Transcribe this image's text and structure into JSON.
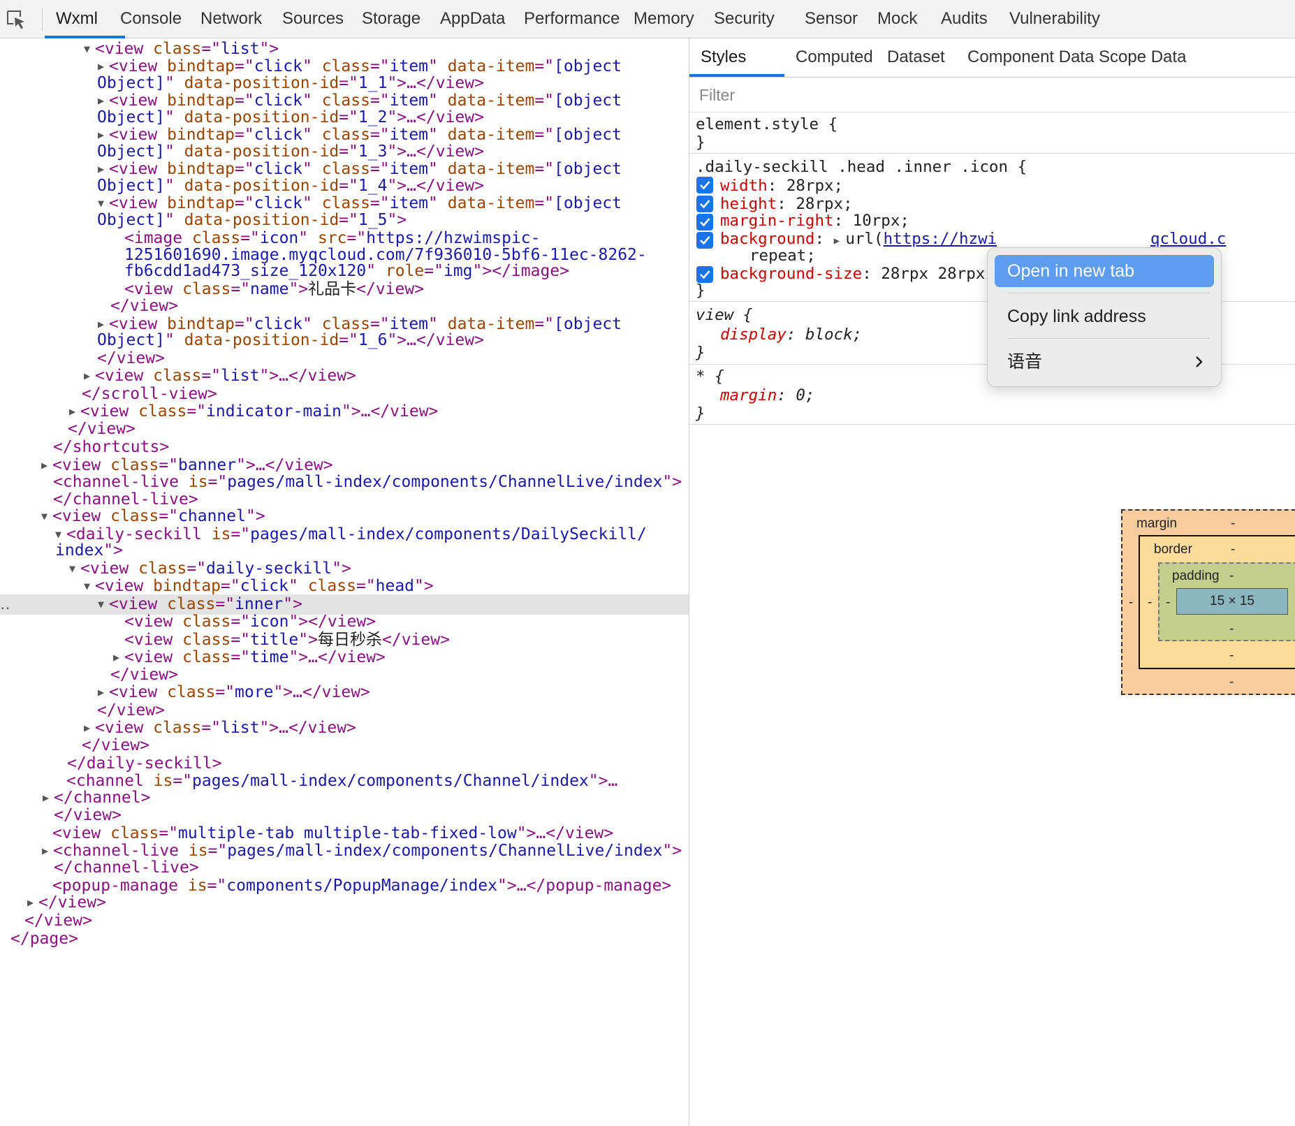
{
  "toolbar": {
    "tabs": [
      "Wxml",
      "Console",
      "Network",
      "Sources",
      "Storage",
      "AppData",
      "Performance",
      "Memory",
      "Security",
      "Sensor",
      "Mock",
      "Audits",
      "Vulnerability"
    ],
    "active_tab": "Wxml"
  },
  "tree": {
    "lines": [
      [
        [
          "t",
          "<view "
        ],
        [
          "a",
          "class"
        ],
        [
          "t",
          "=\""
        ],
        [
          "v",
          "list"
        ],
        [
          "t",
          "\">"
        ]
      ],
      [
        [
          "t",
          "<view "
        ],
        [
          "a",
          "bindtap"
        ],
        [
          "t",
          "=\""
        ],
        [
          "v",
          "click"
        ],
        [
          "t",
          "\" "
        ],
        [
          "a",
          "class"
        ],
        [
          "t",
          "=\""
        ],
        [
          "v",
          "item"
        ],
        [
          "t",
          "\" "
        ],
        [
          "a",
          "data-item"
        ],
        [
          "t",
          "=\""
        ],
        [
          "v",
          "[object"
        ]
      ],
      [
        [
          "v",
          "Object]"
        ],
        [
          "t",
          "\" "
        ],
        [
          "a",
          "data-position-id"
        ],
        [
          "t",
          "=\""
        ],
        [
          "v",
          "1_1"
        ],
        [
          "t",
          "\">…</view>"
        ]
      ],
      [
        [
          "t",
          "<view "
        ],
        [
          "a",
          "bindtap"
        ],
        [
          "t",
          "=\""
        ],
        [
          "v",
          "click"
        ],
        [
          "t",
          "\" "
        ],
        [
          "a",
          "class"
        ],
        [
          "t",
          "=\""
        ],
        [
          "v",
          "item"
        ],
        [
          "t",
          "\" "
        ],
        [
          "a",
          "data-item"
        ],
        [
          "t",
          "=\""
        ],
        [
          "v",
          "[object"
        ]
      ],
      [
        [
          "v",
          "Object]"
        ],
        [
          "t",
          "\" "
        ],
        [
          "a",
          "data-position-id"
        ],
        [
          "t",
          "=\""
        ],
        [
          "v",
          "1_2"
        ],
        [
          "t",
          "\">…</view>"
        ]
      ],
      [
        [
          "t",
          "<view "
        ],
        [
          "a",
          "bindtap"
        ],
        [
          "t",
          "=\""
        ],
        [
          "v",
          "click"
        ],
        [
          "t",
          "\" "
        ],
        [
          "a",
          "class"
        ],
        [
          "t",
          "=\""
        ],
        [
          "v",
          "item"
        ],
        [
          "t",
          "\" "
        ],
        [
          "a",
          "data-item"
        ],
        [
          "t",
          "=\""
        ],
        [
          "v",
          "[object"
        ]
      ],
      [
        [
          "v",
          "Object]"
        ],
        [
          "t",
          "\" "
        ],
        [
          "a",
          "data-position-id"
        ],
        [
          "t",
          "=\""
        ],
        [
          "v",
          "1_3"
        ],
        [
          "t",
          "\">…</view>"
        ]
      ],
      [
        [
          "t",
          "<view "
        ],
        [
          "a",
          "bindtap"
        ],
        [
          "t",
          "=\""
        ],
        [
          "v",
          "click"
        ],
        [
          "t",
          "\" "
        ],
        [
          "a",
          "class"
        ],
        [
          "t",
          "=\""
        ],
        [
          "v",
          "item"
        ],
        [
          "t",
          "\" "
        ],
        [
          "a",
          "data-item"
        ],
        [
          "t",
          "=\""
        ],
        [
          "v",
          "[object"
        ]
      ],
      [
        [
          "v",
          "Object]"
        ],
        [
          "t",
          "\" "
        ],
        [
          "a",
          "data-position-id"
        ],
        [
          "t",
          "=\""
        ],
        [
          "v",
          "1_4"
        ],
        [
          "t",
          "\">…</view>"
        ]
      ],
      [
        [
          "t",
          "<view "
        ],
        [
          "a",
          "bindtap"
        ],
        [
          "t",
          "=\""
        ],
        [
          "v",
          "click"
        ],
        [
          "t",
          "\" "
        ],
        [
          "a",
          "class"
        ],
        [
          "t",
          "=\""
        ],
        [
          "v",
          "item"
        ],
        [
          "t",
          "\" "
        ],
        [
          "a",
          "data-item"
        ],
        [
          "t",
          "=\""
        ],
        [
          "v",
          "[object"
        ]
      ],
      [
        [
          "v",
          "Object]"
        ],
        [
          "t",
          "\" "
        ],
        [
          "a",
          "data-position-id"
        ],
        [
          "t",
          "=\""
        ],
        [
          "v",
          "1_5"
        ],
        [
          "t",
          "\">"
        ]
      ],
      [
        [
          "t",
          "<image "
        ],
        [
          "a",
          "class"
        ],
        [
          "t",
          "=\""
        ],
        [
          "v",
          "icon"
        ],
        [
          "t",
          "\" "
        ],
        [
          "a",
          "src"
        ],
        [
          "t",
          "=\""
        ],
        [
          "v",
          "https://hzwimspic-"
        ]
      ],
      [
        [
          "v",
          "1251601690.image.myqcloud.com/7f936010-5bf6-11ec-8262-"
        ]
      ],
      [
        [
          "v",
          "fb6cdd1ad473_size_120x120"
        ],
        [
          "t",
          "\" "
        ],
        [
          "a",
          "role"
        ],
        [
          "t",
          "=\""
        ],
        [
          "v",
          "img"
        ],
        [
          "t",
          "\"></image>"
        ]
      ],
      [
        [
          "t",
          "<view "
        ],
        [
          "a",
          "class"
        ],
        [
          "t",
          "=\""
        ],
        [
          "v",
          "name"
        ],
        [
          "t",
          "\">"
        ],
        [
          "x",
          "礼品卡"
        ],
        [
          "t",
          "</view>"
        ]
      ],
      [
        [
          "t",
          "</view>"
        ]
      ],
      [
        [
          "t",
          "<view "
        ],
        [
          "a",
          "bindtap"
        ],
        [
          "t",
          "=\""
        ],
        [
          "v",
          "click"
        ],
        [
          "t",
          "\" "
        ],
        [
          "a",
          "class"
        ],
        [
          "t",
          "=\""
        ],
        [
          "v",
          "item"
        ],
        [
          "t",
          "\" "
        ],
        [
          "a",
          "data-item"
        ],
        [
          "t",
          "=\""
        ],
        [
          "v",
          "[object"
        ]
      ],
      [
        [
          "v",
          "Object]"
        ],
        [
          "t",
          "\" "
        ],
        [
          "a",
          "data-position-id"
        ],
        [
          "t",
          "=\""
        ],
        [
          "v",
          "1_6"
        ],
        [
          "t",
          "\">…</view>"
        ]
      ],
      [
        [
          "t",
          "</view>"
        ]
      ],
      [
        [
          "t",
          "<view "
        ],
        [
          "a",
          "class"
        ],
        [
          "t",
          "=\""
        ],
        [
          "v",
          "list"
        ],
        [
          "t",
          "\">…</view>"
        ]
      ],
      [
        [
          "t",
          "</scroll-view>"
        ]
      ],
      [
        [
          "t",
          "<view "
        ],
        [
          "a",
          "class"
        ],
        [
          "t",
          "=\""
        ],
        [
          "v",
          "indicator-main"
        ],
        [
          "t",
          "\">…</view>"
        ]
      ],
      [
        [
          "t",
          "</view>"
        ]
      ],
      [
        [
          "t",
          "</shortcuts>"
        ]
      ],
      [
        [
          "t",
          "<view "
        ],
        [
          "a",
          "class"
        ],
        [
          "t",
          "=\""
        ],
        [
          "v",
          "banner"
        ],
        [
          "t",
          "\">…</view>"
        ]
      ],
      [
        [
          "t",
          "<channel-live "
        ],
        [
          "a",
          "is"
        ],
        [
          "t",
          "=\""
        ],
        [
          "v",
          "pages/mall-index/components/ChannelLive/index"
        ],
        [
          "t",
          "\">"
        ]
      ],
      [
        [
          "t",
          "</channel-live>"
        ]
      ],
      [
        [
          "t",
          "<view "
        ],
        [
          "a",
          "class"
        ],
        [
          "t",
          "=\""
        ],
        [
          "v",
          "channel"
        ],
        [
          "t",
          "\">"
        ]
      ],
      [
        [
          "t",
          "<daily-seckill "
        ],
        [
          "a",
          "is"
        ],
        [
          "t",
          "=\""
        ],
        [
          "v",
          "pages/mall-index/components/DailySeckill/"
        ]
      ],
      [
        [
          "v",
          "index"
        ],
        [
          "t",
          "\">"
        ]
      ],
      [
        [
          "t",
          "<view "
        ],
        [
          "a",
          "class"
        ],
        [
          "t",
          "=\""
        ],
        [
          "v",
          "daily-seckill"
        ],
        [
          "t",
          "\">"
        ]
      ],
      [
        [
          "t",
          "<view "
        ],
        [
          "a",
          "bindtap"
        ],
        [
          "t",
          "=\""
        ],
        [
          "v",
          "click"
        ],
        [
          "t",
          "\" "
        ],
        [
          "a",
          "class"
        ],
        [
          "t",
          "=\""
        ],
        [
          "v",
          "head"
        ],
        [
          "t",
          "\">"
        ]
      ],
      [
        [
          "t",
          "<view "
        ],
        [
          "a",
          "class"
        ],
        [
          "t",
          "=\""
        ],
        [
          "v",
          "inner"
        ],
        [
          "t",
          "\">"
        ]
      ],
      [
        [
          "t",
          "<view "
        ],
        [
          "a",
          "class"
        ],
        [
          "t",
          "=\""
        ],
        [
          "v",
          "icon"
        ],
        [
          "t",
          "\"></view>"
        ]
      ],
      [
        [
          "t",
          "<view "
        ],
        [
          "a",
          "class"
        ],
        [
          "t",
          "=\""
        ],
        [
          "v",
          "title"
        ],
        [
          "t",
          "\">"
        ],
        [
          "x",
          "每日秒杀"
        ],
        [
          "t",
          "</view>"
        ]
      ],
      [
        [
          "t",
          "<view "
        ],
        [
          "a",
          "class"
        ],
        [
          "t",
          "=\""
        ],
        [
          "v",
          "time"
        ],
        [
          "t",
          "\">…</view>"
        ]
      ],
      [
        [
          "t",
          "</view>"
        ]
      ],
      [
        [
          "t",
          "<view "
        ],
        [
          "a",
          "class"
        ],
        [
          "t",
          "=\""
        ],
        [
          "v",
          "more"
        ],
        [
          "t",
          "\">…</view>"
        ]
      ],
      [
        [
          "t",
          "</view>"
        ]
      ],
      [
        [
          "t",
          "<view "
        ],
        [
          "a",
          "class"
        ],
        [
          "t",
          "=\""
        ],
        [
          "v",
          "list"
        ],
        [
          "t",
          "\">…</view>"
        ]
      ],
      [
        [
          "t",
          "</view>"
        ]
      ],
      [
        [
          "t",
          "</daily-seckill>"
        ]
      ],
      [
        [
          "t",
          "<channel "
        ],
        [
          "a",
          "is"
        ],
        [
          "t",
          "=\""
        ],
        [
          "v",
          "pages/mall-index/components/Channel/index"
        ],
        [
          "t",
          "\">…"
        ]
      ],
      [
        [
          "t",
          "</channel>"
        ]
      ],
      [
        [
          "t",
          "</view>"
        ]
      ],
      [
        [
          "t",
          "<view "
        ],
        [
          "a",
          "class"
        ],
        [
          "t",
          "=\""
        ],
        [
          "v",
          "multiple-tab multiple-tab-fixed-low"
        ],
        [
          "t",
          "\">…</view>"
        ]
      ],
      [
        [
          "t",
          "<channel-live "
        ],
        [
          "a",
          "is"
        ],
        [
          "t",
          "=\""
        ],
        [
          "v",
          "pages/mall-index/components/ChannelLive/index"
        ],
        [
          "t",
          "\">"
        ]
      ],
      [
        [
          "t",
          "</channel-live>"
        ]
      ],
      [
        [
          "t",
          "<popup-manage "
        ],
        [
          "a",
          "is"
        ],
        [
          "t",
          "=\""
        ],
        [
          "v",
          "components/PopupManage/index"
        ],
        [
          "t",
          "\">…</popup-manage>"
        ]
      ],
      [
        [
          "t",
          "</view>"
        ]
      ],
      [
        [
          "t",
          "</view>"
        ]
      ],
      [
        [
          "t",
          "</page>"
        ]
      ]
    ],
    "selected_dots": "‥"
  },
  "styles": {
    "tabs": [
      "Styles",
      "Computed",
      "Dataset",
      "Component Data",
      "Scope Data"
    ],
    "active_tab": "Styles",
    "filter_placeholder": "Filter",
    "element_style_open": "element.style {",
    "close_brace": "}",
    "rule_selector": ".daily-seckill .head .inner .icon {",
    "width_prop": "width",
    "width_val": ": 28rpx;",
    "height_prop": "height",
    "height_val": ": 28rpx;",
    "mr_prop": "margin-right",
    "mr_val": ": 10rpx;",
    "bg_prop": "background",
    "bg_colon": ": ",
    "bg_url_fn": "url(",
    "bg_link": "https://hzwi",
    "bg_link_tail": "qcloud.c",
    "bg_repeat": "repeat;",
    "bgs_prop": "background-size",
    "bgs_val": ": 28rpx 28rpx;",
    "view_selector": "view {",
    "display_prop": "display",
    "display_val": ": block;",
    "star_selector": "* {",
    "margin_prop": "margin",
    "margin_val": ": 0;"
  },
  "context_menu": {
    "open_new_tab": "Open in new tab",
    "copy_link": "Copy link address",
    "language": "语音"
  },
  "box_model": {
    "margin_label": "margin",
    "border_label": "border",
    "padding_label": "padding",
    "dash": "-",
    "content_size": "15 × 15"
  },
  "colors": {
    "accent": "#1a73e8",
    "tag": "#881280",
    "attr": "#994500",
    "value": "#1a1aa6",
    "menu_highlight": "#5e9cf0"
  }
}
